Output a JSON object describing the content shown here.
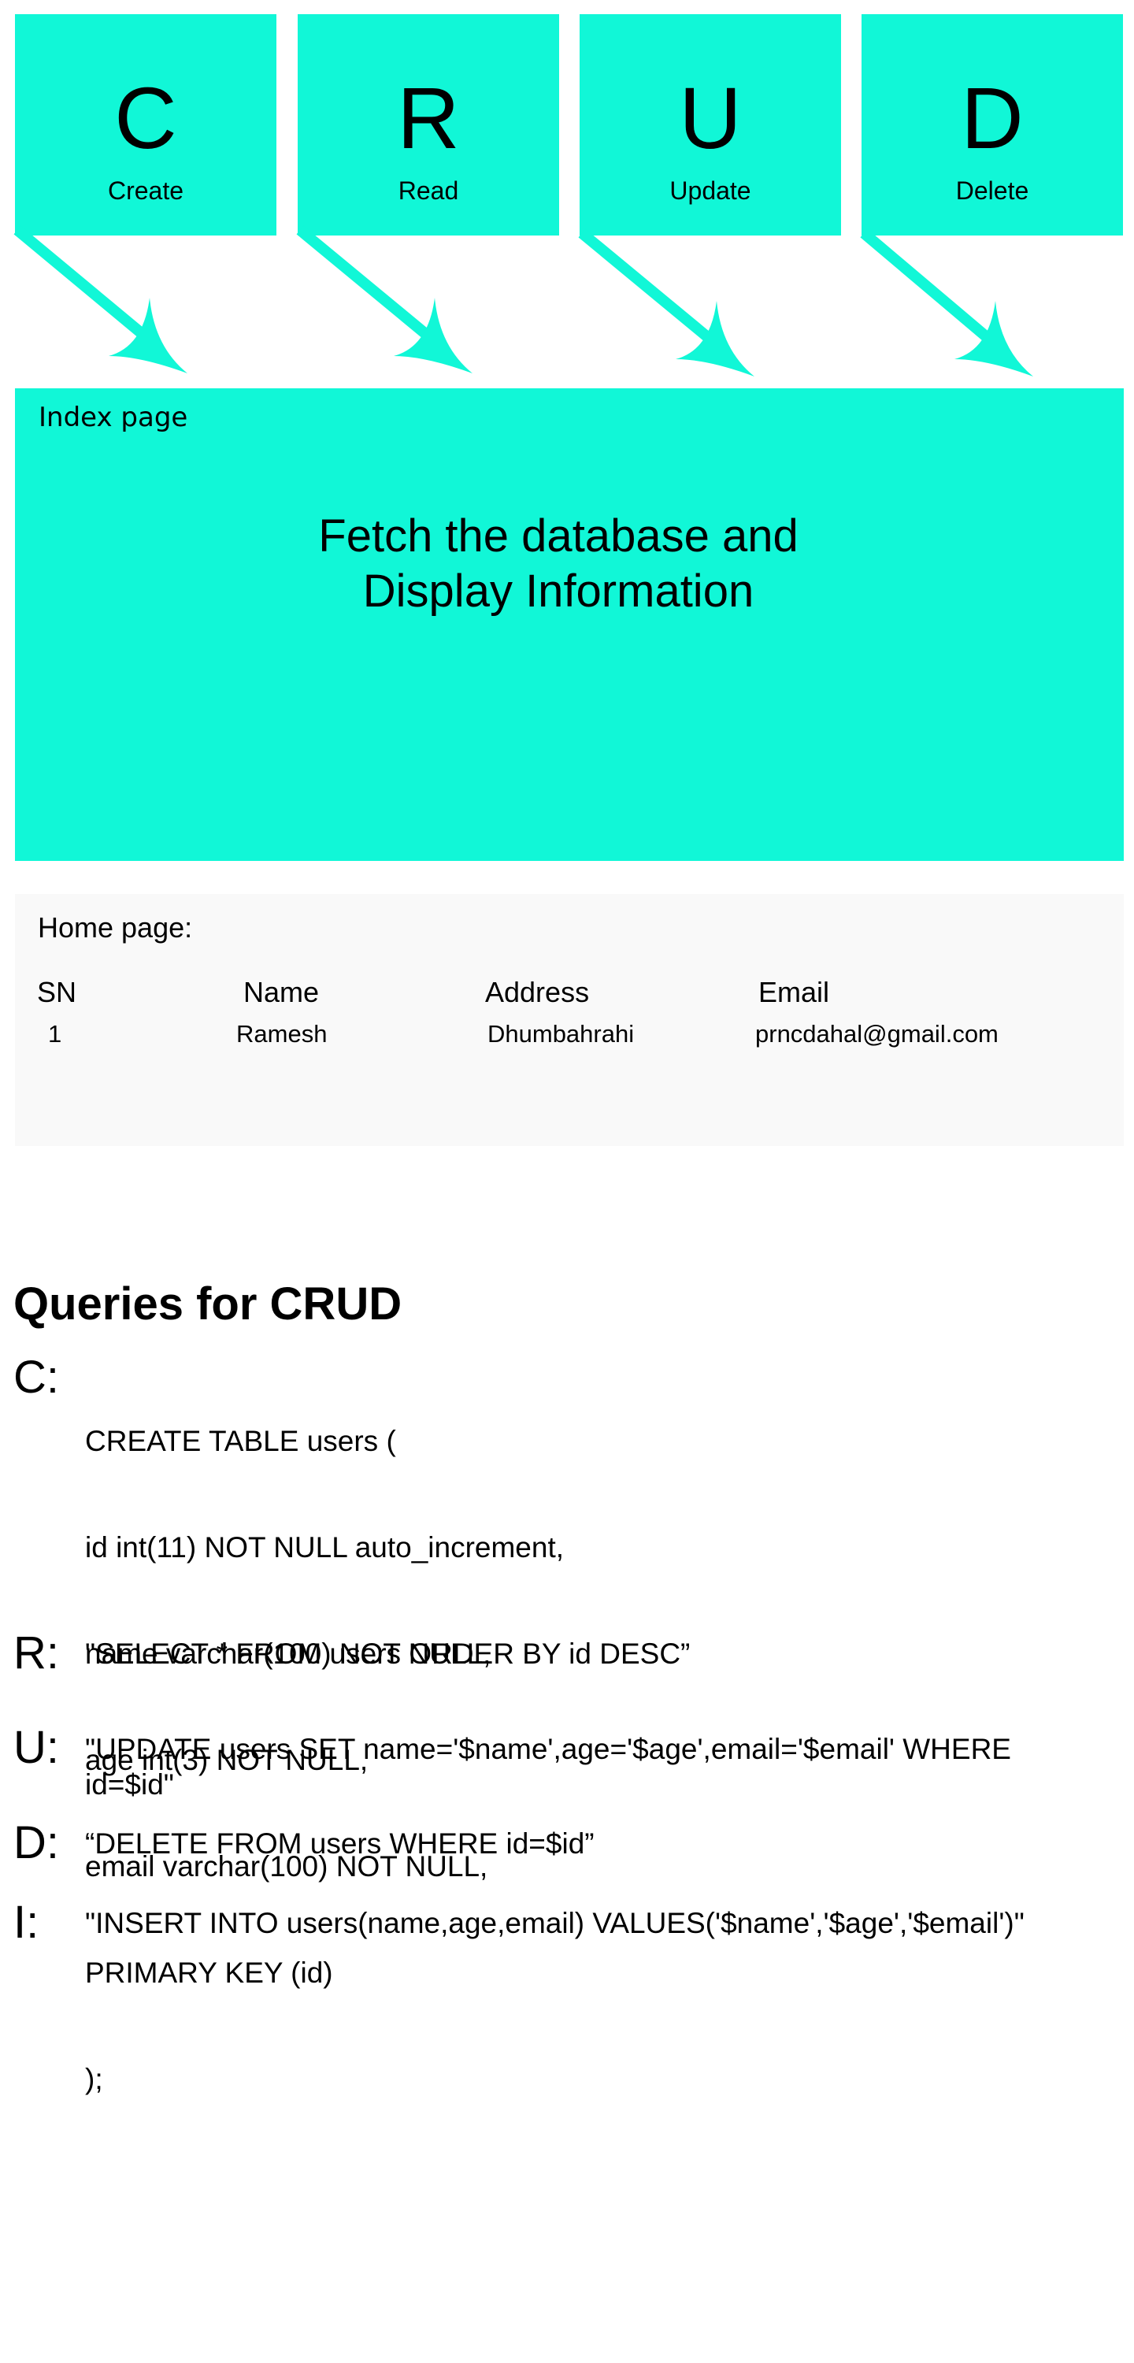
{
  "crud_boxes": [
    {
      "letter": "C",
      "word": "Create"
    },
    {
      "letter": "R",
      "word": "Read"
    },
    {
      "letter": "U",
      "word": "Update"
    },
    {
      "letter": "D",
      "word": "Delete"
    }
  ],
  "colors": {
    "accent": "#11f7d7",
    "panel_gray": "#f9f9f9",
    "text": "#000000"
  },
  "index_page": {
    "label": "Index page",
    "line1": "Fetch the database and",
    "line2": "Display Information"
  },
  "home_page": {
    "title": "Home page:",
    "columns": [
      "SN",
      "Name",
      "Address",
      "Email"
    ],
    "rows": [
      [
        "1",
        "Ramesh",
        "Dhumbahrahi",
        "prncdahal@gmail.com"
      ]
    ]
  },
  "queries": {
    "title": "Queries for CRUD",
    "create": {
      "letter": "C:",
      "lines": [
        "CREATE TABLE users (",
        "id int(11) NOT NULL auto_increment,",
        "name varchar(100) NOT NULL,",
        "age int(3) NOT NULL,",
        "email varchar(100) NOT NULL,",
        "PRIMARY KEY (id)",
        ");"
      ]
    },
    "read": {
      "letter": "R:",
      "text": "\"SELECT * FROM users ORDER BY id DESC”"
    },
    "update": {
      "letter": "U:",
      "text": "\"UPDATE users SET name='$name',age='$age',email='$email' WHERE id=$id\""
    },
    "delete": {
      "letter": "D:",
      "text": "“DELETE FROM users WHERE id=$id”"
    },
    "insert": {
      "letter": "I:",
      "text": "\"INSERT INTO users(name,age,email) VALUES('$name','$age','$email')\""
    }
  }
}
